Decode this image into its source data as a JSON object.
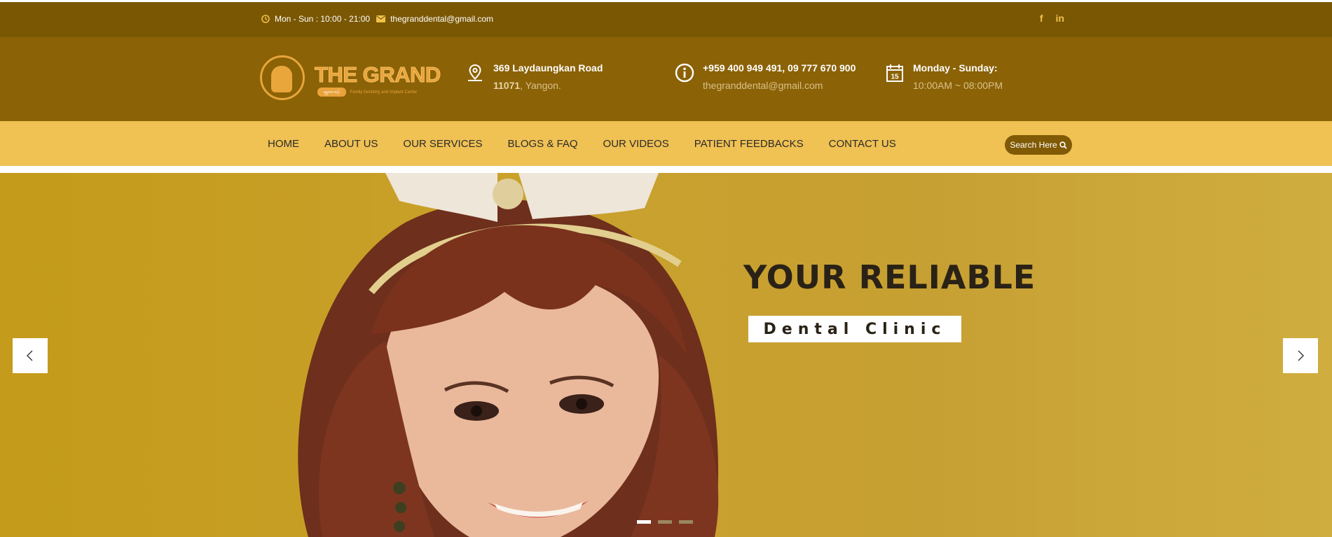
{
  "topbar": {
    "hours": "Mon - Sun : 10:00 - 21:00",
    "email": "thegranddental@gmail.com",
    "social": [
      {
        "icon": "facebook-icon",
        "label": "f"
      },
      {
        "icon": "linkedin-icon",
        "label": "in"
      }
    ]
  },
  "header": {
    "logo": {
      "title": "THE GRAND",
      "tag": "ဒန္တဆေးခန်း",
      "subtitle": "Family Dentistry and Implant Center"
    },
    "address": {
      "line1": "369 Laydaungkan Road",
      "postcode": "11071",
      "city": ", Yangon."
    },
    "contact": {
      "phones": "+959 400 949 491, 09 777 670 900",
      "email": "thegranddental@gmail.com"
    },
    "schedule": {
      "days": "Monday - Sunday:",
      "time": "10:00AM ~ 08:00PM",
      "calendar_day": "15"
    }
  },
  "nav": {
    "items": [
      "HOME",
      "ABOUT US",
      "OUR SERVICES",
      "BLOGS & FAQ",
      "OUR VIDEOS",
      "PATIENT FEEDBACKS",
      "CONTACT US"
    ],
    "search_label": "Search Here"
  },
  "hero": {
    "headline": "YOUR RELIABLE",
    "subheadline": "Dental Clinic",
    "slides": 3,
    "active_slide": 1
  },
  "colors": {
    "topbar": "#7a5703",
    "header": "#8b6206",
    "nav": "#f0c153",
    "accent": "#f2c24f",
    "hero_bg": "#c9a12c"
  }
}
